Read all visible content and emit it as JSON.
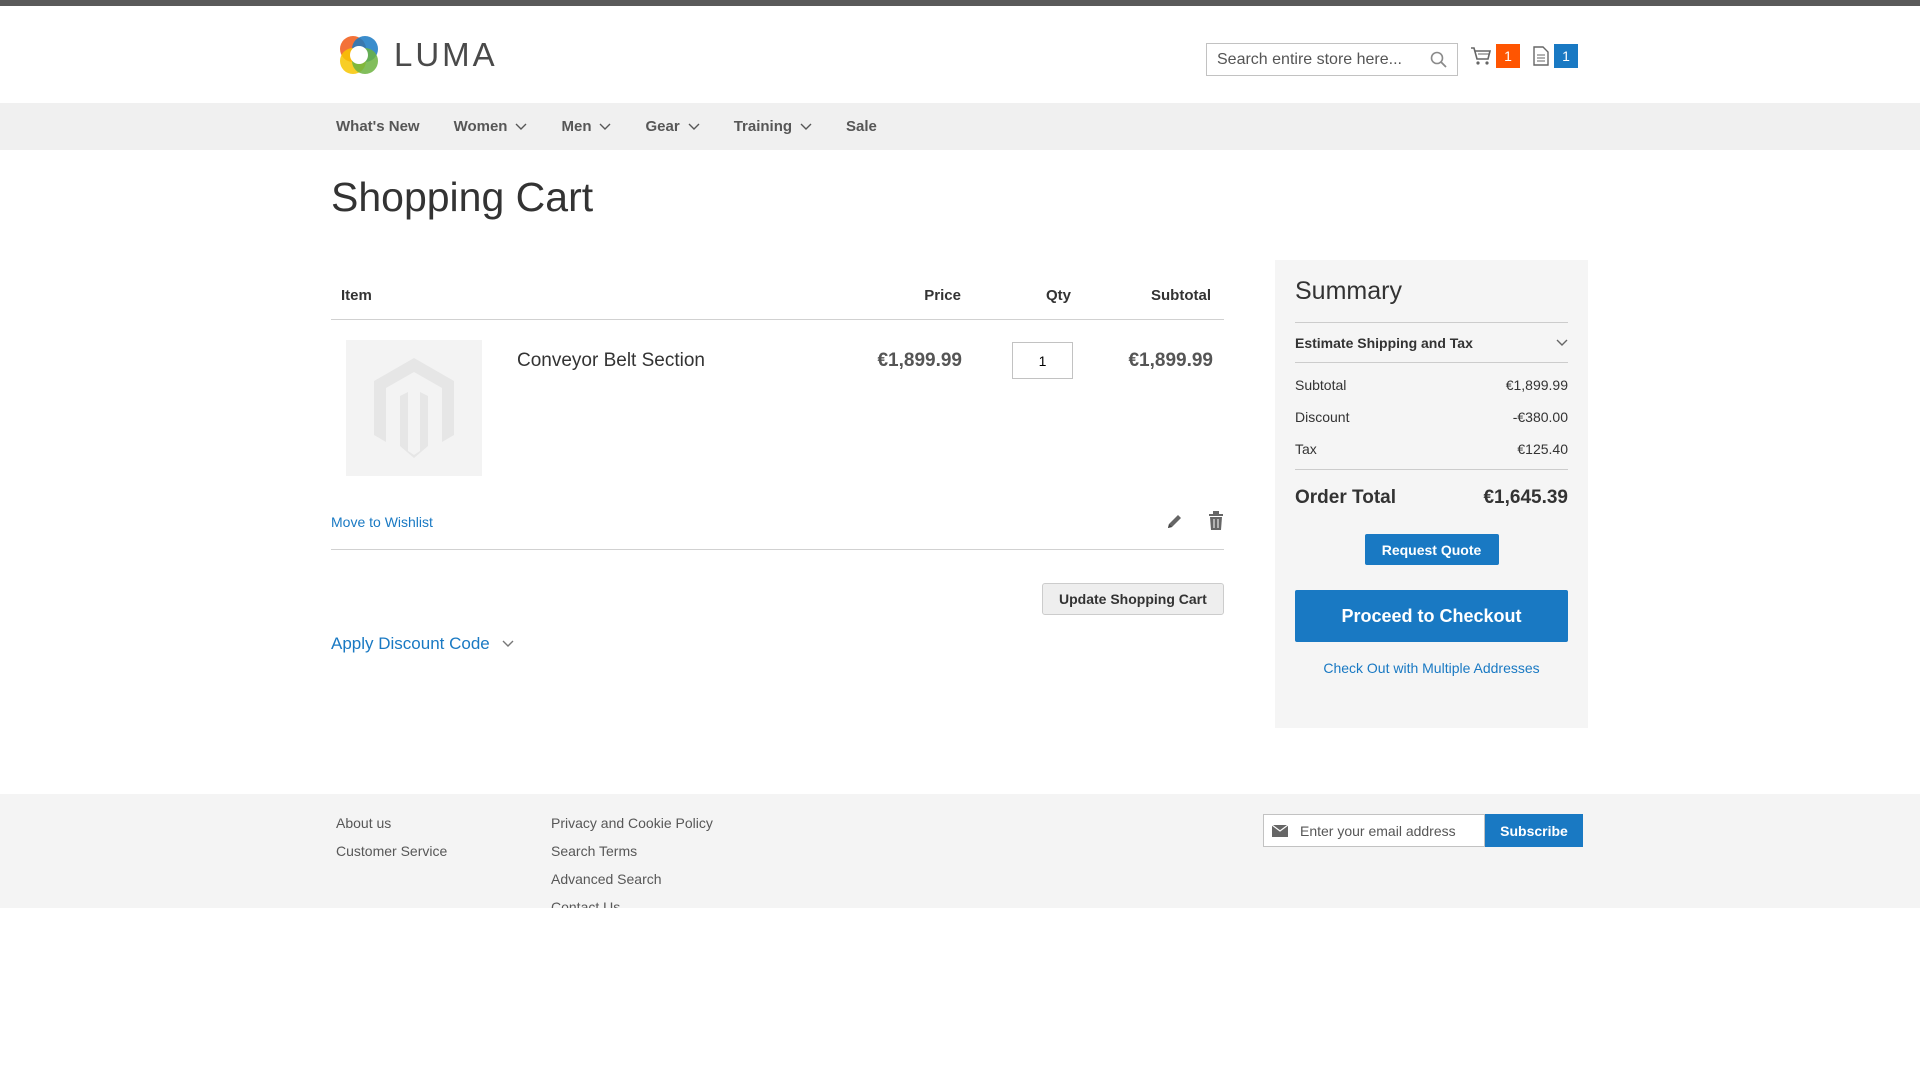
{
  "header": {
    "logo_text": "LUMA",
    "search_placeholder": "Search entire store here...",
    "cart_count": "1",
    "compare_count": "1"
  },
  "nav": {
    "items": [
      {
        "label": "What's New",
        "has_dropdown": false
      },
      {
        "label": "Women",
        "has_dropdown": true
      },
      {
        "label": "Men",
        "has_dropdown": true
      },
      {
        "label": "Gear",
        "has_dropdown": true
      },
      {
        "label": "Training",
        "has_dropdown": true
      },
      {
        "label": "Sale",
        "has_dropdown": false
      }
    ]
  },
  "page": {
    "title": "Shopping Cart"
  },
  "cart": {
    "headers": {
      "item": "Item",
      "price": "Price",
      "qty": "Qty",
      "subtotal": "Subtotal"
    },
    "items": [
      {
        "name": "Conveyor Belt Section",
        "price": "€1,899.99",
        "qty": "1",
        "subtotal": "€1,899.99"
      }
    ],
    "move_to_wishlist": "Move to Wishlist",
    "update_button": "Update Shopping Cart",
    "discount_label": "Apply Discount Code"
  },
  "summary": {
    "title": "Summary",
    "estimate_label": "Estimate Shipping and Tax",
    "lines": [
      {
        "label": "Subtotal",
        "value": "€1,899.99"
      },
      {
        "label": "Discount",
        "value": "-€380.00"
      },
      {
        "label": "Tax",
        "value": "€125.40"
      }
    ],
    "order_total_label": "Order Total",
    "order_total_value": "€1,645.39",
    "request_quote": "Request Quote",
    "checkout": "Proceed to Checkout",
    "multi_address": "Check Out with Multiple Addresses"
  },
  "footer": {
    "col1": [
      "About us",
      "Customer Service"
    ],
    "col2": [
      "Privacy and Cookie Policy",
      "Search Terms",
      "Advanced Search",
      "Contact Us"
    ],
    "newsletter_placeholder": "Enter your email address",
    "subscribe": "Subscribe"
  },
  "colors": {
    "accent": "#1979c3",
    "cart_badge": "#ff5501",
    "link": "#1979c3"
  }
}
